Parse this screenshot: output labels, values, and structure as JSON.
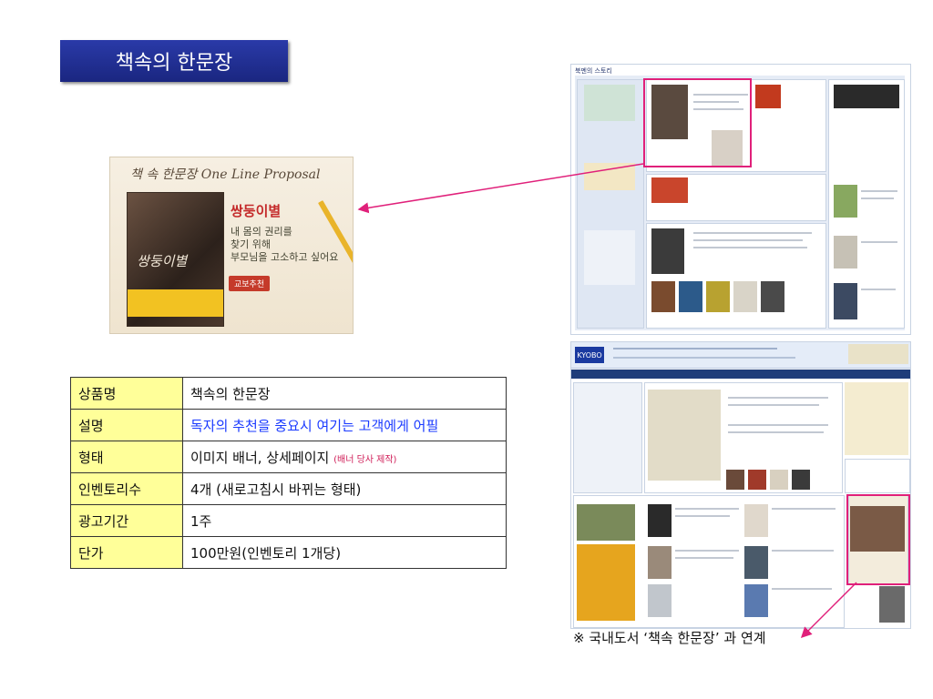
{
  "title": "책속의 한문장",
  "banner": {
    "heading": "책 속 한문장 One Line Proposal",
    "book_cover_title": "쌍둥이별",
    "headline": "쌍둥이별",
    "description": "내 몸의 권리를\n찾기 위해\n부모님을 고소하고 싶어요",
    "tag": "교보추천"
  },
  "table": {
    "rows": [
      {
        "key": "상품명",
        "value": "책속의 한문장"
      },
      {
        "key": "설명",
        "value": "독자의 추천을 중요시 여기는 고객에게 어필"
      },
      {
        "key": "형태",
        "value": "이미지 배너, 상세페이지",
        "note": "(배너 당사 제작)"
      },
      {
        "key": "인벤토리수",
        "value": "4개 (새로고침시 바뀌는 형태)"
      },
      {
        "key": "광고기간",
        "value": "1주"
      },
      {
        "key": "단가",
        "value": "100만원(인벤토리 1개당)"
      }
    ]
  },
  "screenshot_top": {
    "label": "북멘의 스토리"
  },
  "screenshot_bottom": {
    "logo": "KYOBO"
  },
  "caption": "※ 국내도서 ‘책속 한문장’ 과 연계",
  "colors": {
    "title_bg": "#1f2a8f",
    "highlight": "#e0207a",
    "table_key_bg": "#ffff99",
    "blue_text": "#1a3aff"
  }
}
